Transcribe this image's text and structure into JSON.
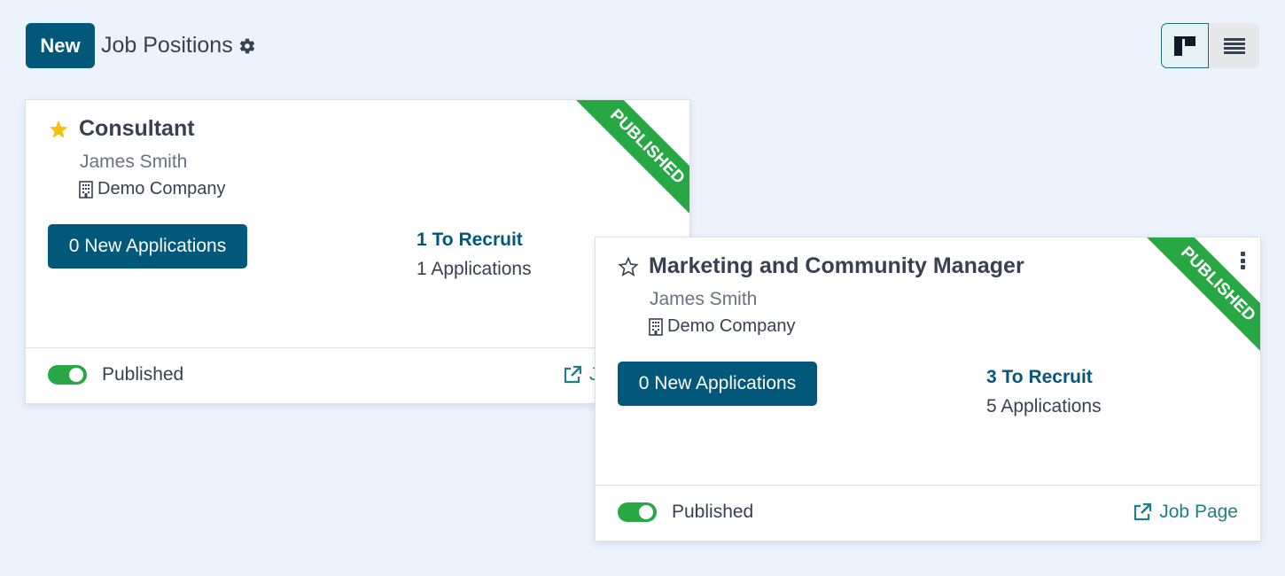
{
  "header": {
    "new_label": "New",
    "title": "Job Positions",
    "settings_icon": "gear-icon"
  },
  "view_switcher": {
    "options": [
      {
        "name": "kanban",
        "icon": "kanban-view-icon",
        "active": true
      },
      {
        "name": "list",
        "icon": "list-view-icon",
        "active": false
      }
    ]
  },
  "colors": {
    "primary": "#02587a",
    "success": "#28a745",
    "link": "#1e7f86",
    "favorite": "#f3c10f",
    "background": "#edf3fd"
  },
  "jobs": [
    {
      "title": "Consultant",
      "favorite": true,
      "manager": "James Smith",
      "company": "Demo Company",
      "ribbon": "PUBLISHED",
      "new_applications_label": "0 New Applications",
      "to_recruit_label": "1 To Recruit",
      "applications_label": "1 Applications",
      "published": true,
      "published_label": "Published",
      "job_page_label": "Job Page"
    },
    {
      "title": "Marketing and Community Manager",
      "favorite": false,
      "manager": "James Smith",
      "company": "Demo Company",
      "ribbon": "PUBLISHED",
      "new_applications_label": "0 New Applications",
      "to_recruit_label": "3 To Recruit",
      "applications_label": "5 Applications",
      "published": true,
      "published_label": "Published",
      "job_page_label": "Job Page"
    }
  ]
}
